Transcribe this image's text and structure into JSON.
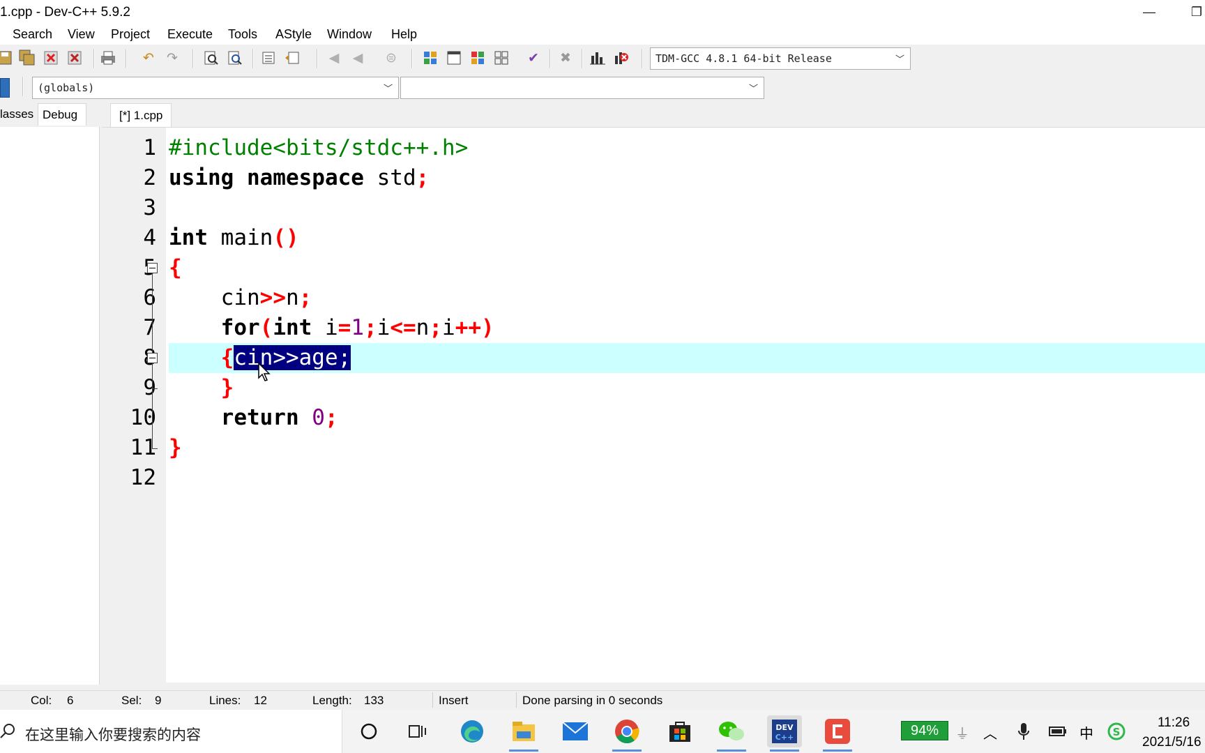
{
  "window": {
    "title": "1.cpp - Dev-C++ 5.9.2"
  },
  "menu": [
    "Search",
    "View",
    "Project",
    "Execute",
    "Tools",
    "AStyle",
    "Window",
    "Help"
  ],
  "toolbar": {
    "compiler": "TDM-GCC 4.8.1 64-bit Release",
    "scope": "(globals)",
    "members": ""
  },
  "left_panel": {
    "tabs": [
      "lasses",
      "Debug"
    ]
  },
  "editor": {
    "tab": "[*] 1.cpp",
    "line_numbers": [
      "1",
      "2",
      "3",
      "4",
      "5",
      "6",
      "7",
      "8",
      "9",
      "10",
      "11",
      "12"
    ],
    "code": {
      "l1": "#include<bits/stdc++.h>",
      "l2_kw": "using namespace",
      "l2_id": " std",
      "l2_semi": ";",
      "l4_kw": "int",
      "l4_id": " main",
      "l4_paren": "()",
      "l5": "{",
      "l6_indent": "    ",
      "l6_id1": "cin",
      "l6_op": ">>",
      "l6_id2": "n",
      "l6_semi": ";",
      "l7_kw1": "for",
      "l7_p1": "(",
      "l7_kw2": "int",
      "l7_id1": " i",
      "l7_op1": "=",
      "l7_num": "1",
      "l7_s1": ";",
      "l7_id2": "i",
      "l7_op2": "<=",
      "l7_id3": "n",
      "l7_s2": ";",
      "l7_id4": "i",
      "l7_op3": "++",
      "l7_p2": ")",
      "l8_brace": "{",
      "l8_sel": "cin>>age;",
      "l9": "}",
      "l10_kw": "return",
      "l10_num": " 0",
      "l10_semi": ";",
      "l11": "}"
    }
  },
  "status": {
    "col_label": "Col:",
    "col": "6",
    "sel_label": "Sel:",
    "sel": "9",
    "lines_label": "Lines:",
    "lines": "12",
    "length_label": "Length:",
    "length": "133",
    "mode": "Insert",
    "message": "Done parsing in 0 seconds"
  },
  "taskbar": {
    "search_placeholder": "在这里输入你要搜索的内容",
    "battery": "94%",
    "ime": "中",
    "time": "11:26",
    "date": "2021/5/16"
  },
  "colors": {
    "keyword": "#000000",
    "preprocessor": "#008000",
    "symbol": "#ff0000",
    "number": "#800080",
    "active_line": "#ccffff",
    "selection": "#000080"
  }
}
